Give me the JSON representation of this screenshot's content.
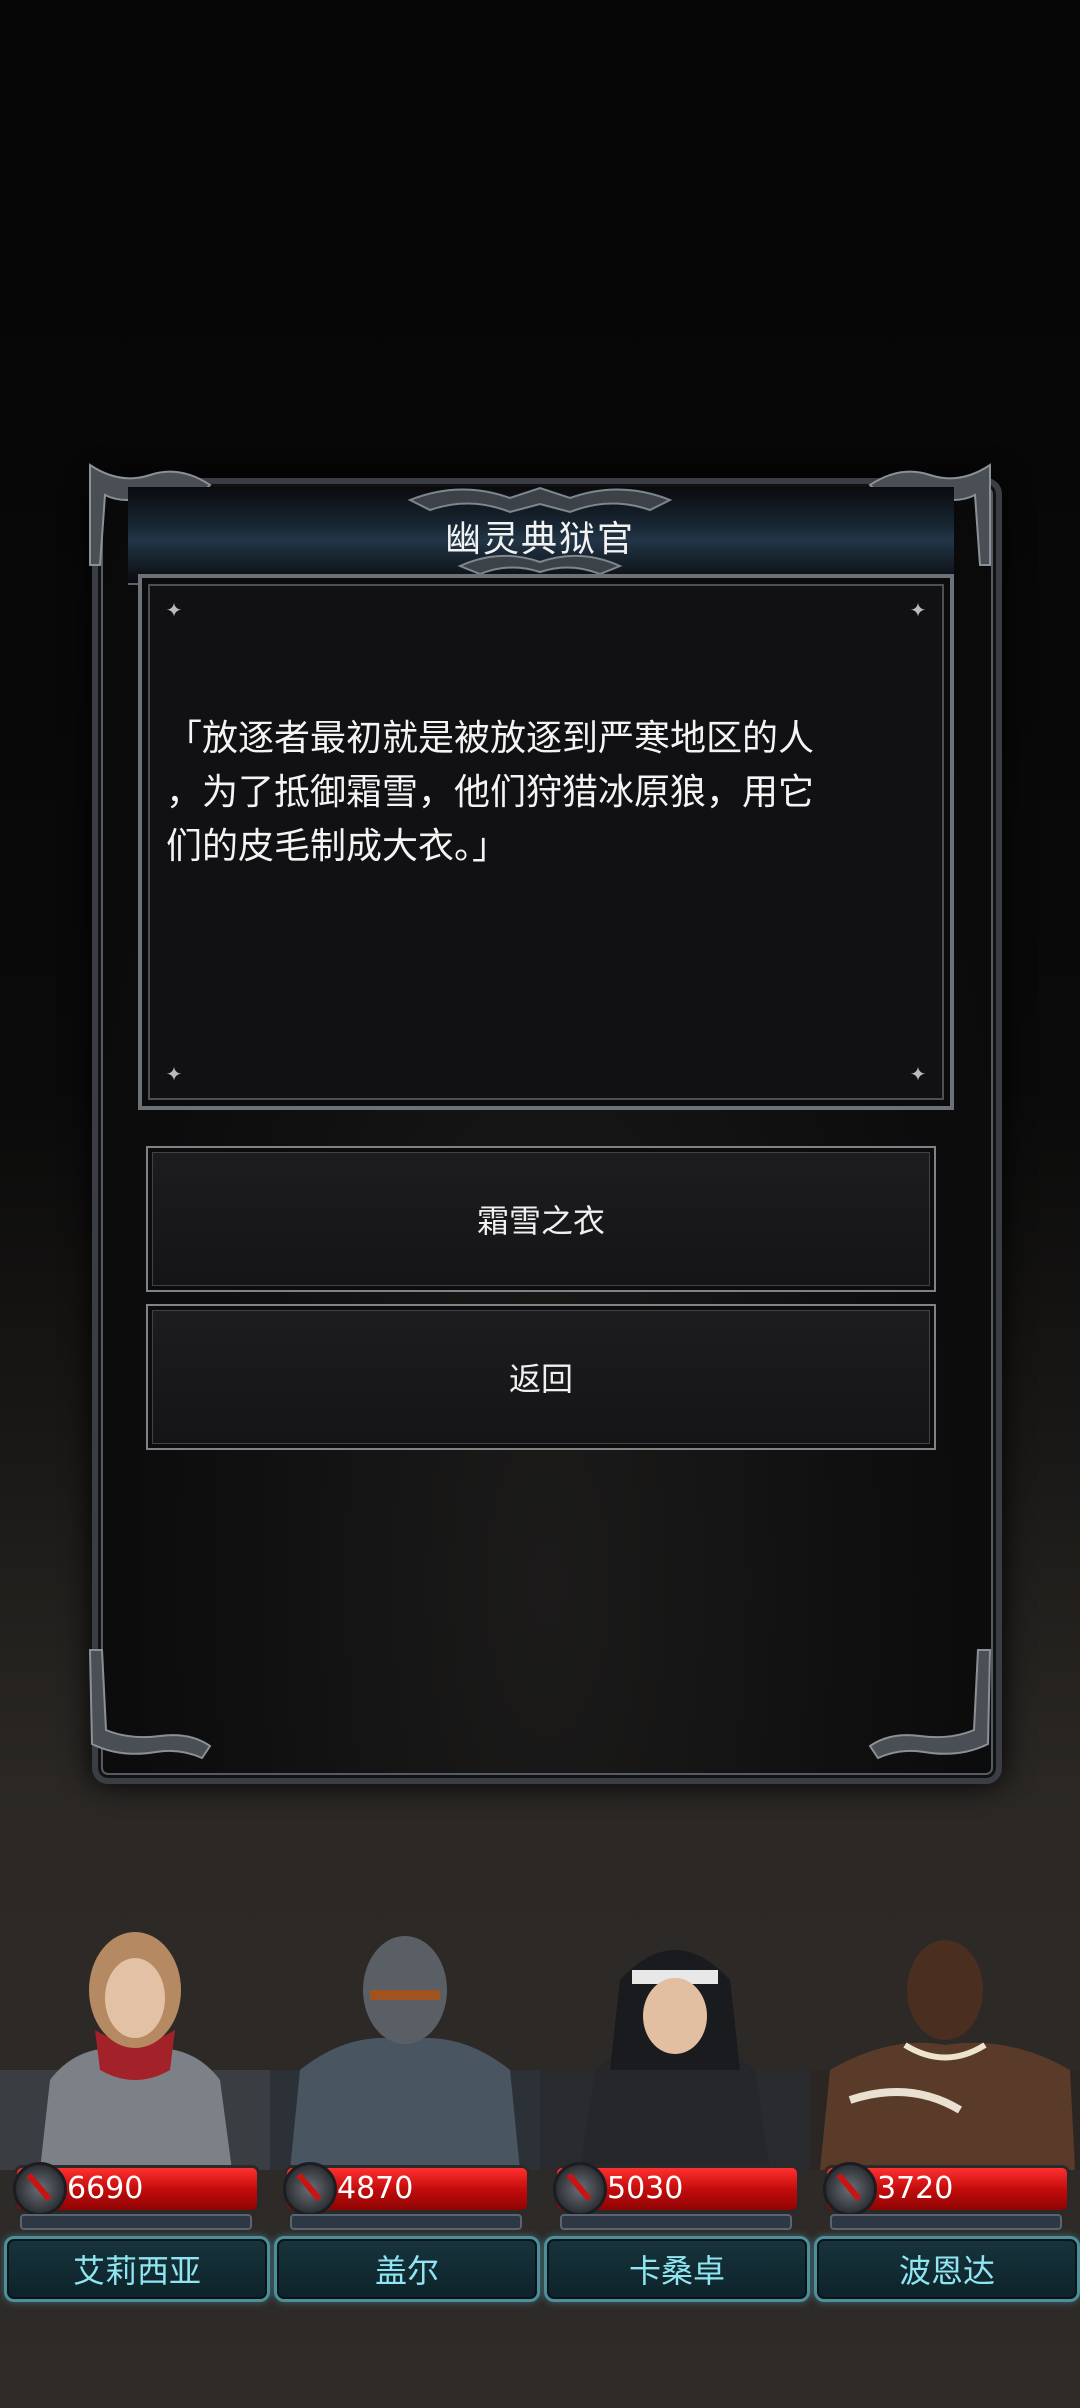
{
  "dialog": {
    "speaker": "幽灵典狱官",
    "text_lines": [
      "「放逐者最初就是被放逐到严寒地区的人",
      "，为了抵御霜雪，他们狩猎冰原狼，用它",
      "们的皮毛制成大衣。」"
    ],
    "choices": [
      "霜雪之衣",
      "返回"
    ]
  },
  "party": [
    {
      "name": "艾莉西亚",
      "hp": "6690"
    },
    {
      "name": "盖尔",
      "hp": "4870"
    },
    {
      "name": "卡桑卓",
      "hp": "5030"
    },
    {
      "name": "波恩达",
      "hp": "3720"
    }
  ],
  "colors": {
    "hp_bar": "#d41414",
    "name_text": "#8fe6f2",
    "name_border": "#4c8f9b"
  }
}
